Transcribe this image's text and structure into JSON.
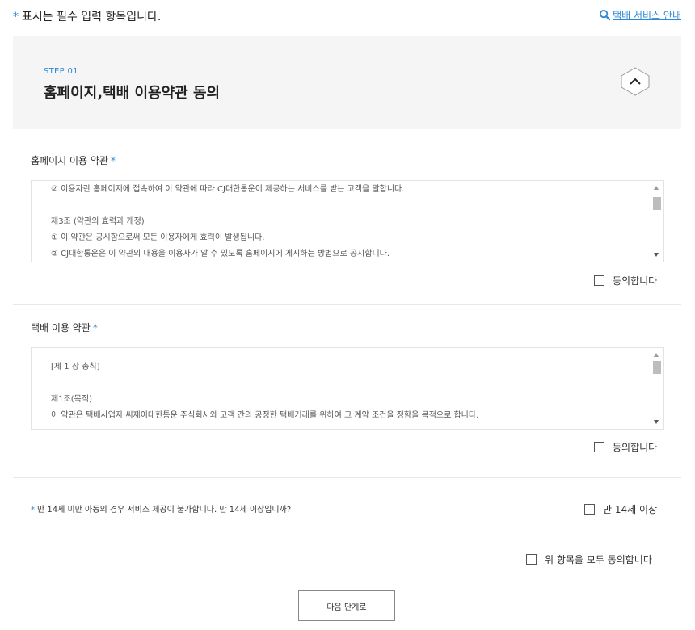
{
  "header": {
    "required_star": "*",
    "required_notice": "표시는 필수 입력 항목입니다.",
    "guide_link": "택배 서비스 안내",
    "guide_icon": "search-icon",
    "accent_color": "#2c89d6"
  },
  "step": {
    "label": "STEP 01",
    "title": "홈페이지,택배 이용약관 동의",
    "toggle_icon": "chevron-up-icon"
  },
  "homepage_terms": {
    "title": "홈페이지 이용 약관",
    "star": "*",
    "lines": [
      "② 이용자란 홈페이지에 접속하여 이 약관에 따라 CJ대한통운이 제공하는 서비스를 받는 고객을 말합니다.",
      "",
      "제3조 (약관의 효력과 개정)",
      "① 이 약관은 공시함으로써 모든 이용자에게 효력이 발생됩니다.",
      "② CJ대한통운은 이 약관의 내용을 이용자가 알 수 있도록 홈페이지에 게시하는 방법으로 공시합니다."
    ],
    "agree_label": "동의합니다"
  },
  "delivery_terms": {
    "title": "택배 이용 약관",
    "star": "*",
    "lines": [
      "[제 1 장 총칙]",
      "",
      "제1조(목적)",
      "이 약관은 택배사업자 씨제이대한통운 주식회사와 고객 간의 공정한 택배거래를 위하여 그 계약 조건을 정함을 목적으로 합니다."
    ],
    "agree_label": "동의합니다"
  },
  "age_check": {
    "star": "*",
    "question": "만 14세 미만 아동의 경우 서비스 제공이 불가합니다. 만 14세 이상입니까?",
    "agree_label": "만 14세 이상"
  },
  "agree_all": {
    "label": "위 항목을 모두 동의합니다"
  },
  "next_button": {
    "label": "다음 단계로"
  }
}
